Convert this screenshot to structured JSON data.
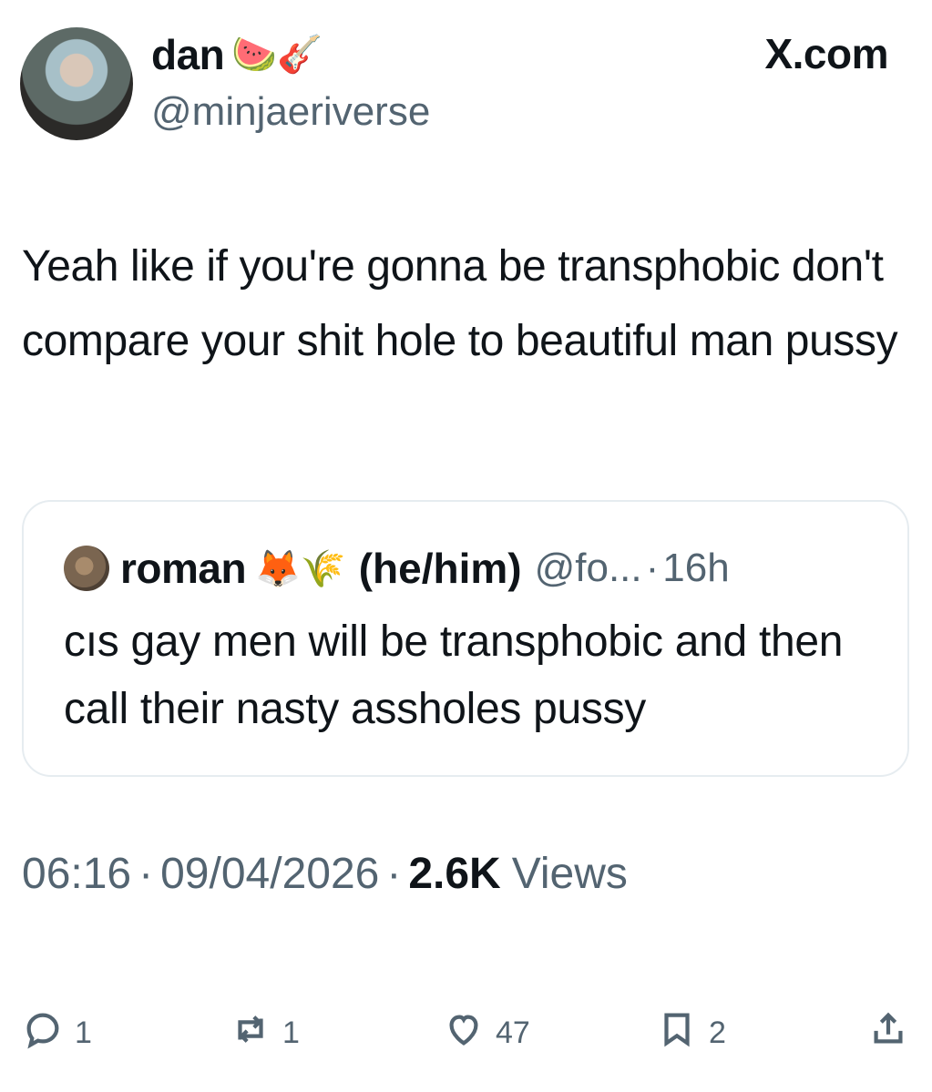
{
  "site_label": "X.com",
  "author": {
    "display_name": "dan",
    "emojis": "🍉🎸",
    "handle": "@minjaeriverse",
    "avatar": "avatar-photo"
  },
  "tweet": {
    "text": "Yeah like if you're gonna be transphobic don't compare your shit hole to beautiful man pussy"
  },
  "quote": {
    "display_name": "roman",
    "emojis": "🦊🌾",
    "pronouns": "(he/him)",
    "handle": "@fo...",
    "dot": "·",
    "time": "16h",
    "text": "cıs gay men will be transphobic and then call their nasty assholes pussy"
  },
  "meta": {
    "time": "06:16",
    "sep1": "·",
    "date": "09/04/2026",
    "sep2": "·",
    "views_count": "2.6K",
    "views_label": "Views"
  },
  "actions": {
    "reply_count": "1",
    "repost_count": "1",
    "like_count": "47",
    "bookmark_count": "2"
  },
  "icons": {
    "reply": "reply-icon",
    "repost": "repost-icon",
    "like": "heart-icon",
    "bookmark": "bookmark-icon",
    "share": "share-icon"
  }
}
